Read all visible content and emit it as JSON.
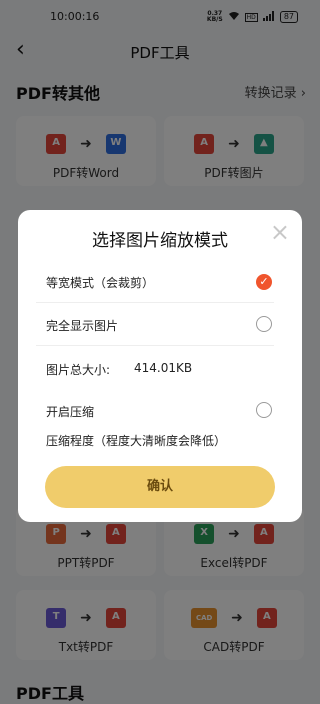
{
  "status": {
    "time": "10:00:16",
    "speed_top": "0.37",
    "speed_unit": "KB/S",
    "sim": "HD",
    "battery": "87"
  },
  "header": {
    "back_glyph": "‹",
    "title": "PDF工具"
  },
  "sections": {
    "pdf_to_other": "PDF转其他",
    "history": "转换记录 ›",
    "pdf_tools": "PDF工具"
  },
  "cards": [
    {
      "label": "PDF转Word",
      "from": "PDF",
      "to": "W"
    },
    {
      "label": "PDF转图片",
      "from": "PDF",
      "to": "IMG"
    },
    {
      "label": "PPT转PDF",
      "from": "P",
      "to": "PDF"
    },
    {
      "label": "Excel转PDF",
      "from": "X",
      "to": "PDF"
    },
    {
      "label": "Txt转PDF",
      "from": "T",
      "to": "PDF"
    },
    {
      "label": "CAD转PDF",
      "from": "CAD",
      "to": "PDF"
    }
  ],
  "dialog": {
    "title": "选择图片缩放模式",
    "close_glyph": "×",
    "option_fit_width": "等宽模式（会裁剪）",
    "option_full": "完全显示图片",
    "total_size_label": "图片总大小:",
    "total_size_value": "414.01KB",
    "compress_label": "开启压缩",
    "compress_level_label": "压缩程度（程度大清晰度会降低）",
    "confirm": "确认",
    "check_glyph": "✓"
  },
  "colors": {
    "accent": "#f0552d",
    "button": "#f0cc6b",
    "pdf": "#e5463b",
    "word": "#2f6fe0",
    "excel": "#2aa05a",
    "ppt": "#e96a3c",
    "txt": "#6a5ad6",
    "cad": "#e8922e"
  }
}
